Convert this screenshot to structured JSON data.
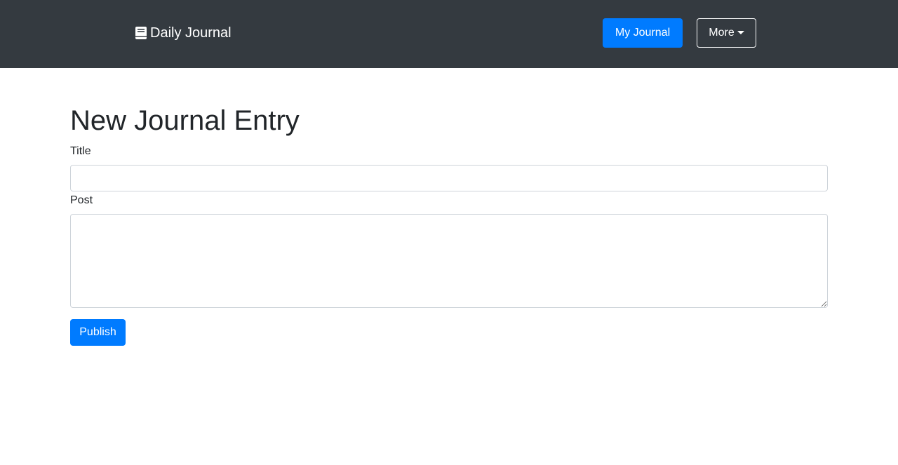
{
  "navbar": {
    "brand": {
      "icon": "book-icon",
      "label": "Daily Journal"
    },
    "my_journal_label": "My Journal",
    "more_label": "More",
    "more_icon": "caret-down-icon",
    "background_color": "#343a40"
  },
  "main": {
    "page_title": "New Journal Entry",
    "form": {
      "title_label": "Title",
      "title_value": "",
      "post_label": "Post",
      "post_value": "",
      "publish_label": "Publish"
    }
  },
  "colors": {
    "primary": "#007bff",
    "text": "#212529",
    "input_border": "#ced4da"
  }
}
